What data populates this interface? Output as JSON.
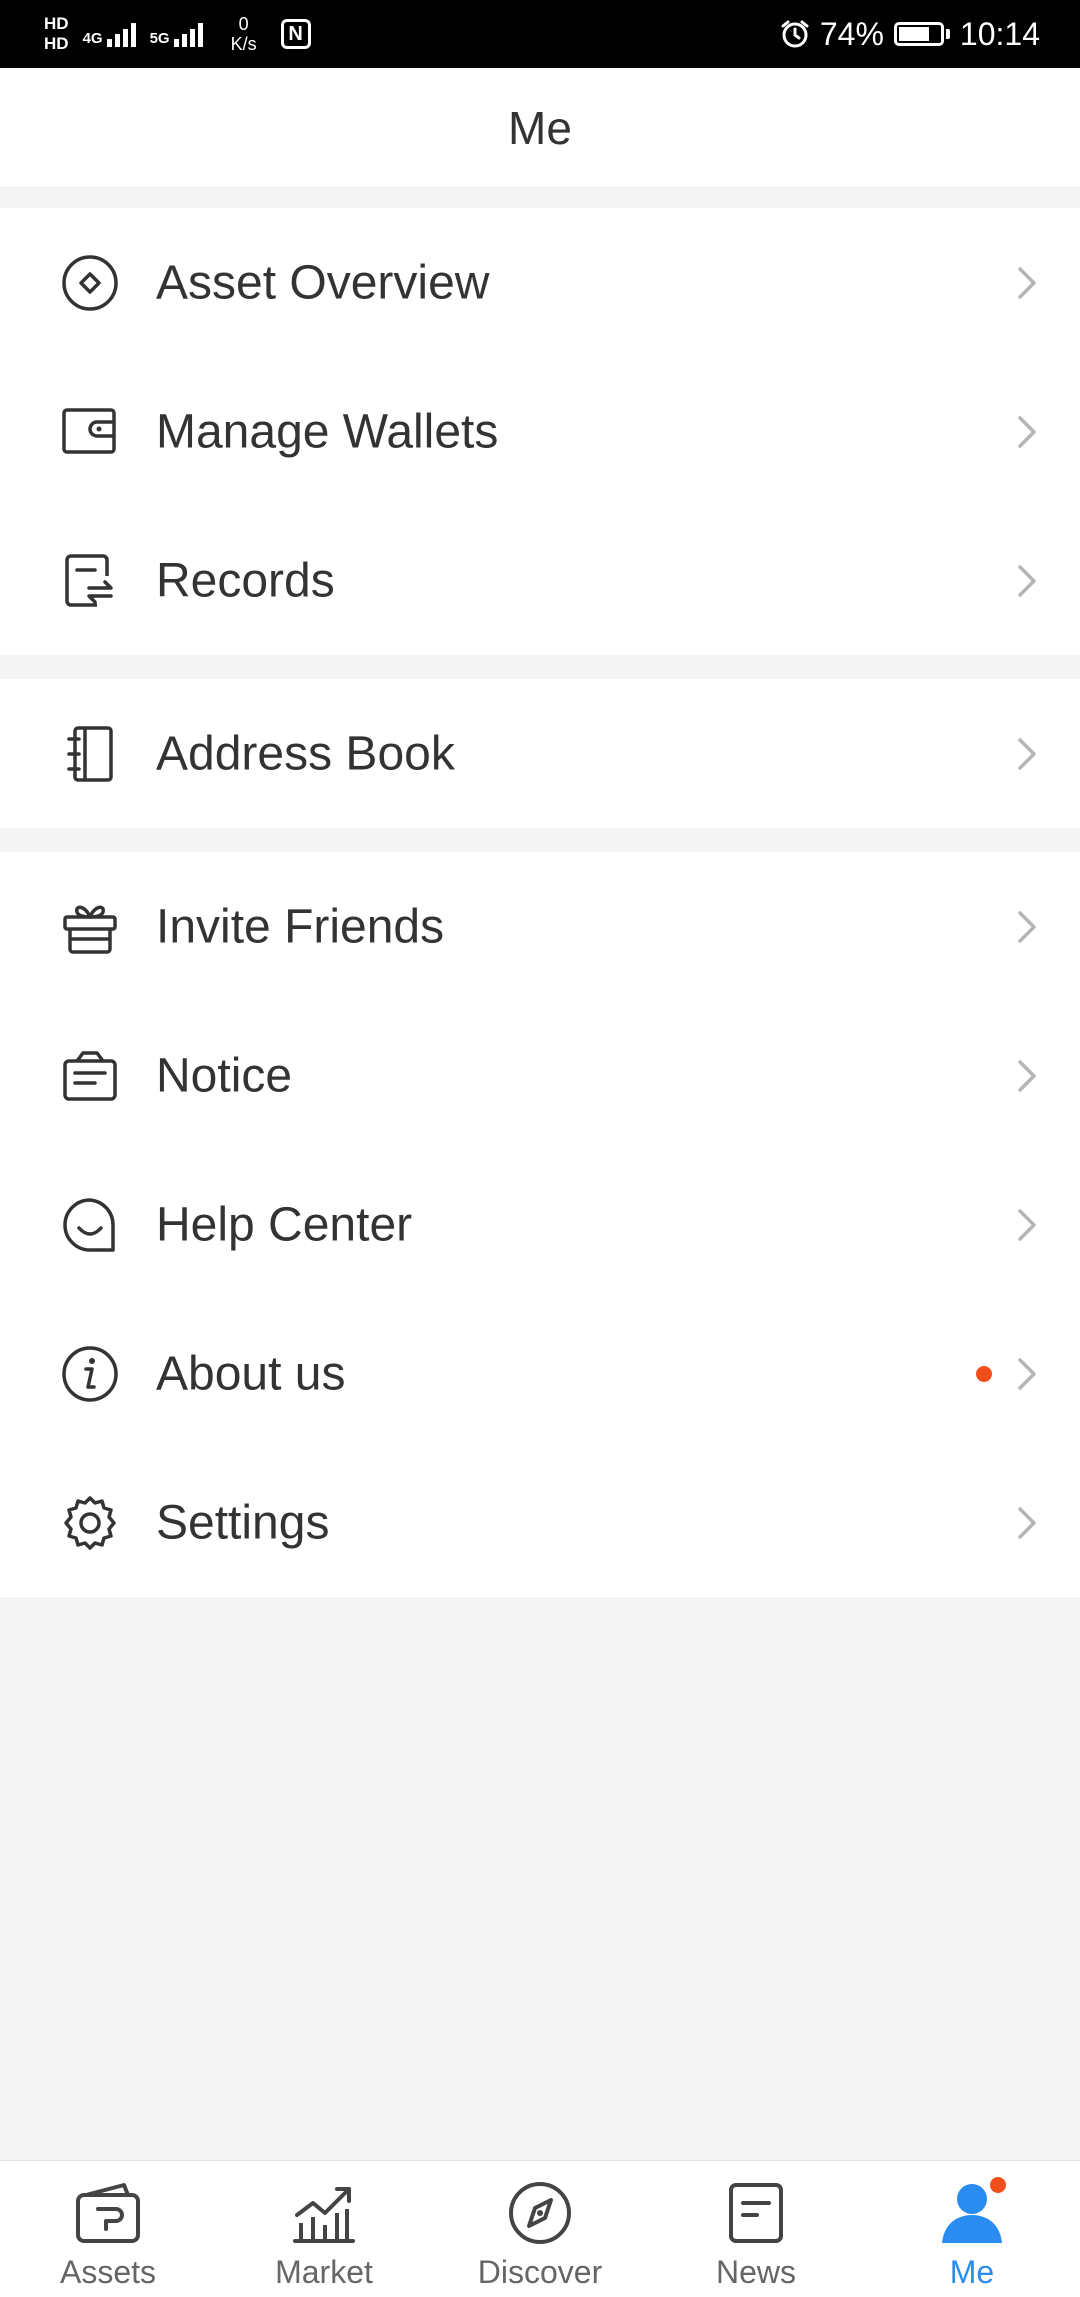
{
  "status_bar": {
    "hd_top": "HD",
    "hd_bottom": "HD",
    "net1": "4G",
    "net2": "5G",
    "speed_value": "0",
    "speed_unit": "K/s",
    "nfc": "N",
    "battery": "74%",
    "time": "10:14"
  },
  "header": {
    "title": "Me"
  },
  "groups": [
    [
      {
        "label": "Asset Overview",
        "icon": "asset-overview-icon"
      },
      {
        "label": "Manage Wallets",
        "icon": "wallet-icon"
      },
      {
        "label": "Records",
        "icon": "records-icon"
      }
    ],
    [
      {
        "label": "Address Book",
        "icon": "address-book-icon"
      }
    ],
    [
      {
        "label": "Invite Friends",
        "icon": "gift-icon"
      },
      {
        "label": "Notice",
        "icon": "notice-icon"
      },
      {
        "label": "Help Center",
        "icon": "help-chat-icon"
      },
      {
        "label": "About us",
        "icon": "info-icon",
        "badge": true
      },
      {
        "label": "Settings",
        "icon": "gear-icon"
      }
    ]
  ],
  "nav": [
    {
      "label": "Assets",
      "icon": "wallet-assets-icon"
    },
    {
      "label": "Market",
      "icon": "market-chart-icon"
    },
    {
      "label": "Discover",
      "icon": "compass-icon"
    },
    {
      "label": "News",
      "icon": "news-icon"
    },
    {
      "label": "Me",
      "icon": "person-icon",
      "active": true,
      "badge": true
    }
  ],
  "colors": {
    "accent": "#2a8cf0",
    "badge": "#f04f1b",
    "background": "#f4f4f4",
    "text": "#333333"
  }
}
